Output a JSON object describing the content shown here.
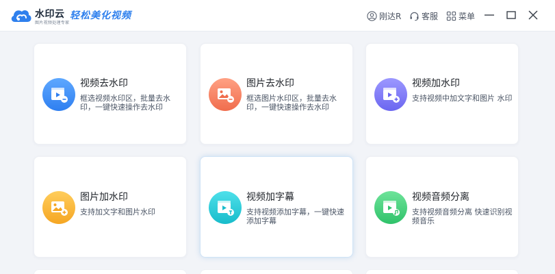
{
  "app": {
    "name": "水印云",
    "subtitle": "图片视频处理专家",
    "slogan": "轻松美化视频"
  },
  "header": {
    "user_label": "刚达R",
    "service_label": "客服",
    "menu_label": "菜单"
  },
  "colors": {
    "brand": "#2f80ed",
    "card_bg": "#ffffff",
    "page_bg": "#f2f4f8"
  },
  "cards": [
    {
      "title": "视频去水印",
      "desc": "框选视频水印区，批量去水印，一键快速操作去水印",
      "icon": "video-remove-icon"
    },
    {
      "title": "图片去水印",
      "desc": "框选图片水印区，批量去水印，一键快速操作去水印",
      "icon": "image-remove-icon"
    },
    {
      "title": "视频加水印",
      "desc": "支持视频中加文字和图片 水印",
      "icon": "video-add-icon"
    },
    {
      "title": "图片加水印",
      "desc": "支持加文字和图片水印",
      "icon": "image-add-icon"
    },
    {
      "title": "视频加字幕",
      "desc": "支持视频添加字幕，一键快速添加字幕",
      "icon": "video-subtitle-icon"
    },
    {
      "title": "视频音频分离",
      "desc": "支持视频音频分离 快速识别视频音乐",
      "icon": "video-audio-split-icon"
    }
  ]
}
